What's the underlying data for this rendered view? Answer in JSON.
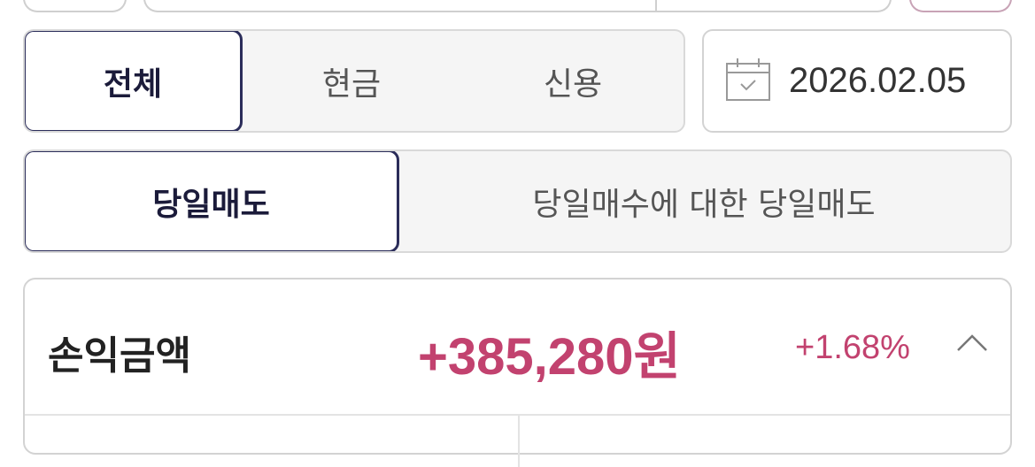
{
  "account_type_tabs": [
    {
      "label": "전체",
      "active": true
    },
    {
      "label": "현금",
      "active": false
    },
    {
      "label": "신용",
      "active": false
    }
  ],
  "date_picker": {
    "value": "2026.02.05",
    "icon": "calendar-icon"
  },
  "trade_type_tabs": [
    {
      "label": "당일매도",
      "active": true
    },
    {
      "label": "당일매수에 대한 당일매도",
      "active": false
    }
  ],
  "summary": {
    "title": "손익금액",
    "amount": "+385,280원",
    "rate": "+1.68%",
    "toggle_icon": "chevron-up-icon"
  },
  "colors": {
    "accent": "#c2426f",
    "active_border": "#2b2d5a"
  }
}
